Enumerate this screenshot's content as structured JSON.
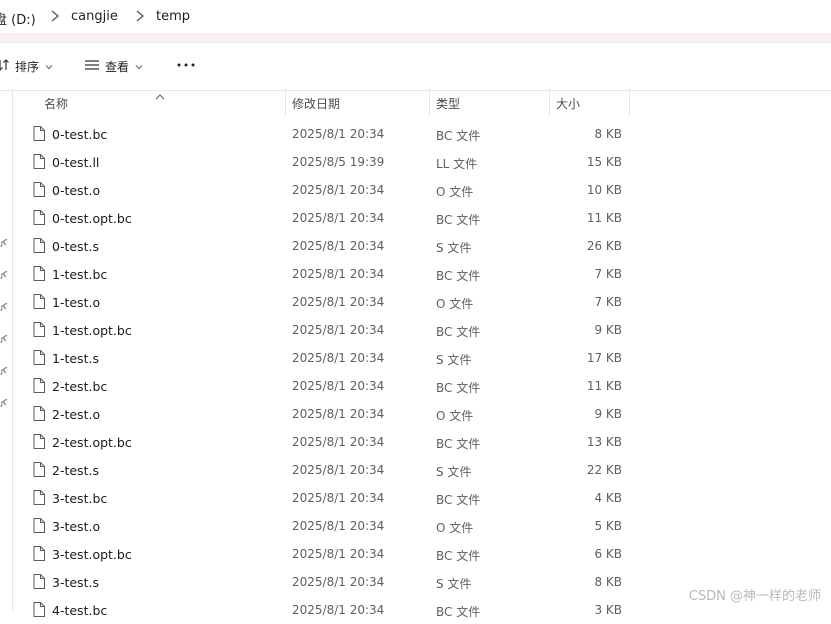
{
  "breadcrumb": {
    "drive": "盘 (D:)",
    "folder1": "cangjie",
    "folder2": "temp"
  },
  "toolbar": {
    "sort_label": "排序",
    "view_label": "查看",
    "more_label": "···"
  },
  "columns": {
    "name": "名称",
    "modified": "修改日期",
    "type": "类型",
    "size": "大小"
  },
  "files": [
    {
      "name": "0-test.bc",
      "modified": "2025/8/1 20:34",
      "type": "BC 文件",
      "size": "8 KB"
    },
    {
      "name": "0-test.ll",
      "modified": "2025/8/5 19:39",
      "type": "LL 文件",
      "size": "15 KB"
    },
    {
      "name": "0-test.o",
      "modified": "2025/8/1 20:34",
      "type": "O 文件",
      "size": "10 KB"
    },
    {
      "name": "0-test.opt.bc",
      "modified": "2025/8/1 20:34",
      "type": "BC 文件",
      "size": "11 KB"
    },
    {
      "name": "0-test.s",
      "modified": "2025/8/1 20:34",
      "type": "S 文件",
      "size": "26 KB"
    },
    {
      "name": "1-test.bc",
      "modified": "2025/8/1 20:34",
      "type": "BC 文件",
      "size": "7 KB"
    },
    {
      "name": "1-test.o",
      "modified": "2025/8/1 20:34",
      "type": "O 文件",
      "size": "7 KB"
    },
    {
      "name": "1-test.opt.bc",
      "modified": "2025/8/1 20:34",
      "type": "BC 文件",
      "size": "9 KB"
    },
    {
      "name": "1-test.s",
      "modified": "2025/8/1 20:34",
      "type": "S 文件",
      "size": "17 KB"
    },
    {
      "name": "2-test.bc",
      "modified": "2025/8/1 20:34",
      "type": "BC 文件",
      "size": "11 KB"
    },
    {
      "name": "2-test.o",
      "modified": "2025/8/1 20:34",
      "type": "O 文件",
      "size": "9 KB"
    },
    {
      "name": "2-test.opt.bc",
      "modified": "2025/8/1 20:34",
      "type": "BC 文件",
      "size": "13 KB"
    },
    {
      "name": "2-test.s",
      "modified": "2025/8/1 20:34",
      "type": "S 文件",
      "size": "22 KB"
    },
    {
      "name": "3-test.bc",
      "modified": "2025/8/1 20:34",
      "type": "BC 文件",
      "size": "4 KB"
    },
    {
      "name": "3-test.o",
      "modified": "2025/8/1 20:34",
      "type": "O 文件",
      "size": "5 KB"
    },
    {
      "name": "3-test.opt.bc",
      "modified": "2025/8/1 20:34",
      "type": "BC 文件",
      "size": "6 KB"
    },
    {
      "name": "3-test.s",
      "modified": "2025/8/1 20:34",
      "type": "S 文件",
      "size": "8 KB"
    },
    {
      "name": "4-test.bc",
      "modified": "2025/8/1 20:34",
      "type": "BC 文件",
      "size": "3 KB"
    }
  ],
  "watermark": "CSDN @神一样的老师",
  "colors": {
    "band": "#fbf0f1",
    "text": "#1a1a1a",
    "muted": "#5f5f5f"
  }
}
